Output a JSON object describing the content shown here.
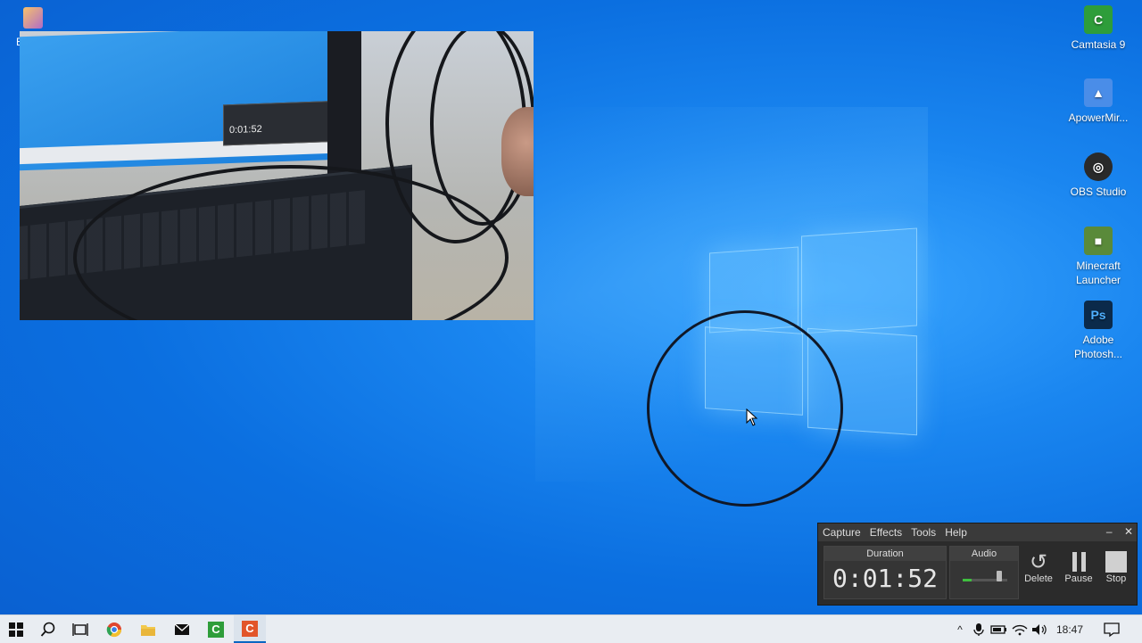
{
  "desktop": {
    "icons": [
      {
        "label": "Camtasia 9",
        "icon": "camtasia-icon",
        "color": "#2e9d3a"
      },
      {
        "label": "ApowerMir...",
        "icon": "apowermirror-icon",
        "color": "#4a8de8"
      },
      {
        "label": "OBS Studio",
        "icon": "obs-icon",
        "color": "#2a2a2a"
      },
      {
        "label": "Minecraft Launcher",
        "icon": "minecraft-icon",
        "color": "#5a8a3a"
      },
      {
        "label": "Adobe Photosh...",
        "icon": "photoshop-icon",
        "color": "#0b2a4a"
      }
    ],
    "topleft_icon_label_fragment": "B"
  },
  "webcam": {
    "mini_duration": "0:01:52"
  },
  "recorder": {
    "menu": [
      "Capture",
      "Effects",
      "Tools",
      "Help"
    ],
    "minimize_label": "–",
    "close_label": "✕",
    "duration_label": "Duration",
    "duration_value": "0:01:52",
    "audio_label": "Audio",
    "audio_level": 0.2,
    "buttons": {
      "delete": "Delete",
      "pause": "Pause",
      "stop": "Stop"
    }
  },
  "taskbar": {
    "apps": [
      "start-icon",
      "search-icon",
      "task-view-icon",
      "chrome-icon",
      "file-explorer-icon",
      "mail-icon",
      "camtasia-icon",
      "camtasia-recorder-icon"
    ],
    "clock": "18:47",
    "tray_icons": [
      "chevron-up-icon",
      "microphone-icon",
      "battery-icon",
      "wifi-icon",
      "volume-icon",
      "notification-icon"
    ]
  },
  "colors": {
    "desktop_blue": "#0b6fe0",
    "recorder_bg": "#2b2b2b",
    "taskbar_bg": "#e9edf2"
  }
}
